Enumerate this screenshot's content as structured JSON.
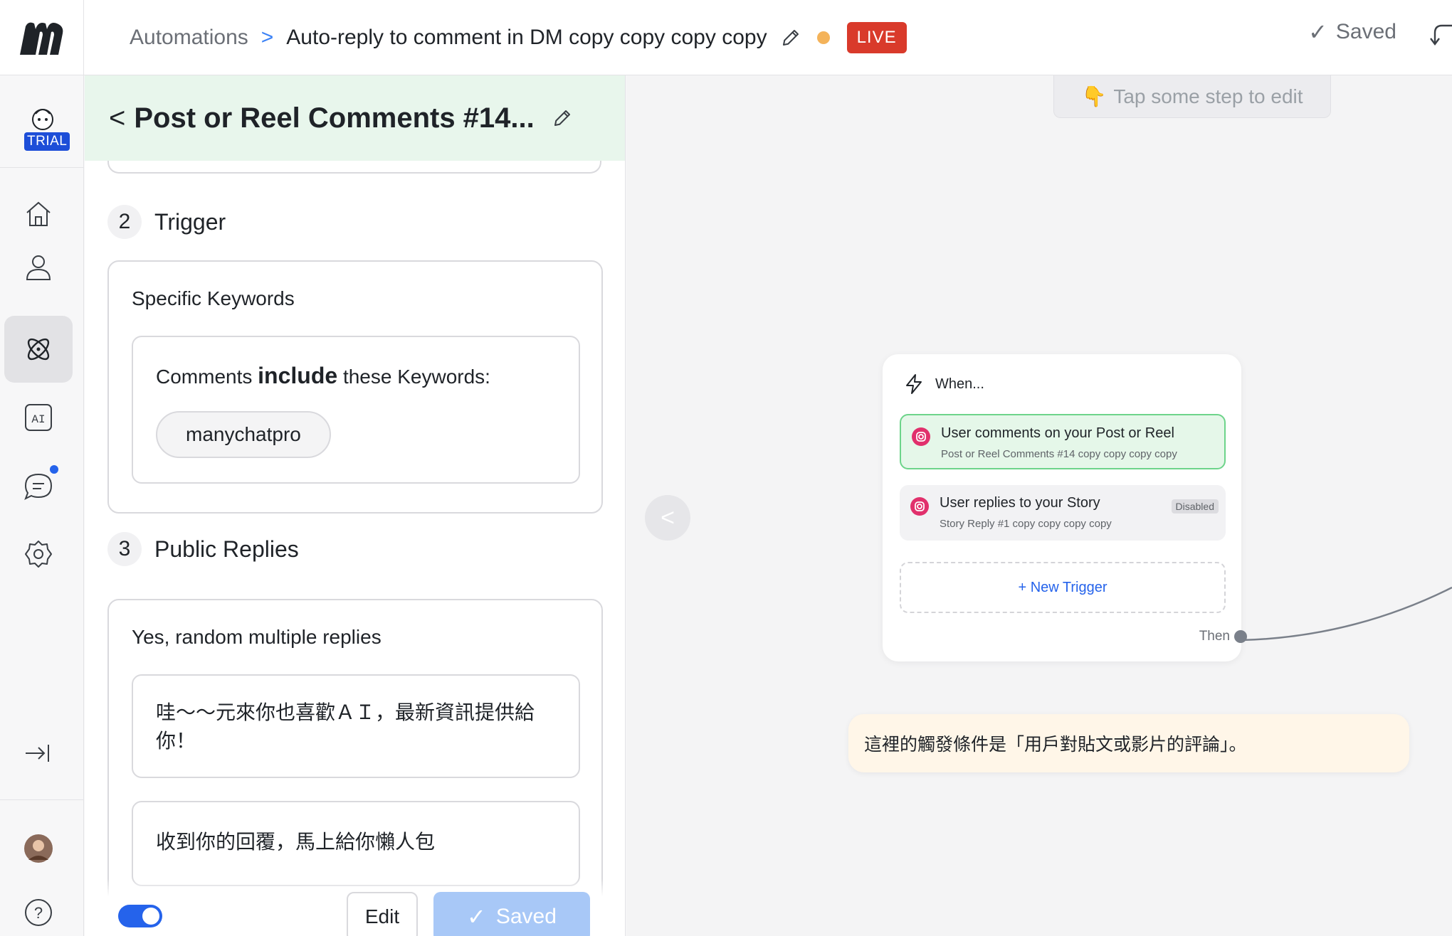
{
  "topbar": {
    "breadcrumb_root": "Automations",
    "breadcrumb_sep": ">",
    "automation_title": "Auto-reply to comment in DM copy copy copy copy",
    "live_label": "LIVE",
    "status_dot_color": "#f4b35a",
    "saved_label": "Saved"
  },
  "rail": {
    "trial_label": "TRIAL",
    "items": [
      {
        "name": "home-icon"
      },
      {
        "name": "contacts-icon"
      },
      {
        "name": "automation-icon",
        "active": true
      },
      {
        "name": "ai-icon",
        "text": "AI"
      },
      {
        "name": "chat-icon",
        "notification": true
      },
      {
        "name": "gear-icon"
      },
      {
        "name": "collapse-icon"
      },
      {
        "name": "user-avatar"
      },
      {
        "name": "help-icon",
        "text": "?"
      }
    ]
  },
  "panel": {
    "back_label": "<",
    "title": "Post or Reel Comments #14...",
    "sections": [
      {
        "number": "2",
        "label": "Trigger"
      },
      {
        "number": "3",
        "label": "Public Replies"
      }
    ],
    "trigger_card": {
      "title": "Specific Keywords",
      "keywords_prefix": "Comments",
      "keywords_strong": "include",
      "keywords_suffix": "these Keywords:",
      "keyword_chip": "manychatpro"
    },
    "replies_card": {
      "title": "Yes, random multiple replies",
      "replies": [
        "哇～～元來你也喜歡ＡＩ，最新資訊提供給你！",
        "收到你的回覆，馬上給你懶人包"
      ]
    },
    "footer": {
      "toggle_on": true,
      "edit_label": "Edit",
      "saved_label": "Saved"
    }
  },
  "canvas": {
    "hint_icon": "👇",
    "hint": "Tap some step to edit",
    "collapse_label": "<",
    "when_card": {
      "heading": "When...",
      "triggers": [
        {
          "title": "User comments on your Post or Reel",
          "subtitle": "Post or Reel Comments #14 copy copy copy copy",
          "state": "active"
        },
        {
          "title": "User replies to your Story",
          "subtitle": "Story Reply #1 copy copy copy copy",
          "badge": "Disabled"
        }
      ],
      "new_trigger_label": "+ New Trigger",
      "then_label": "Then"
    },
    "note": "這裡的觸發條件是「用戶對貼文或影片的評論」。"
  },
  "colors": {
    "accent": "#2563eb",
    "live": "#d93a2b",
    "panel_header": "#e8f6ec",
    "trigger_active_border": "#6dd48a",
    "note_bg": "#fff6e8"
  }
}
